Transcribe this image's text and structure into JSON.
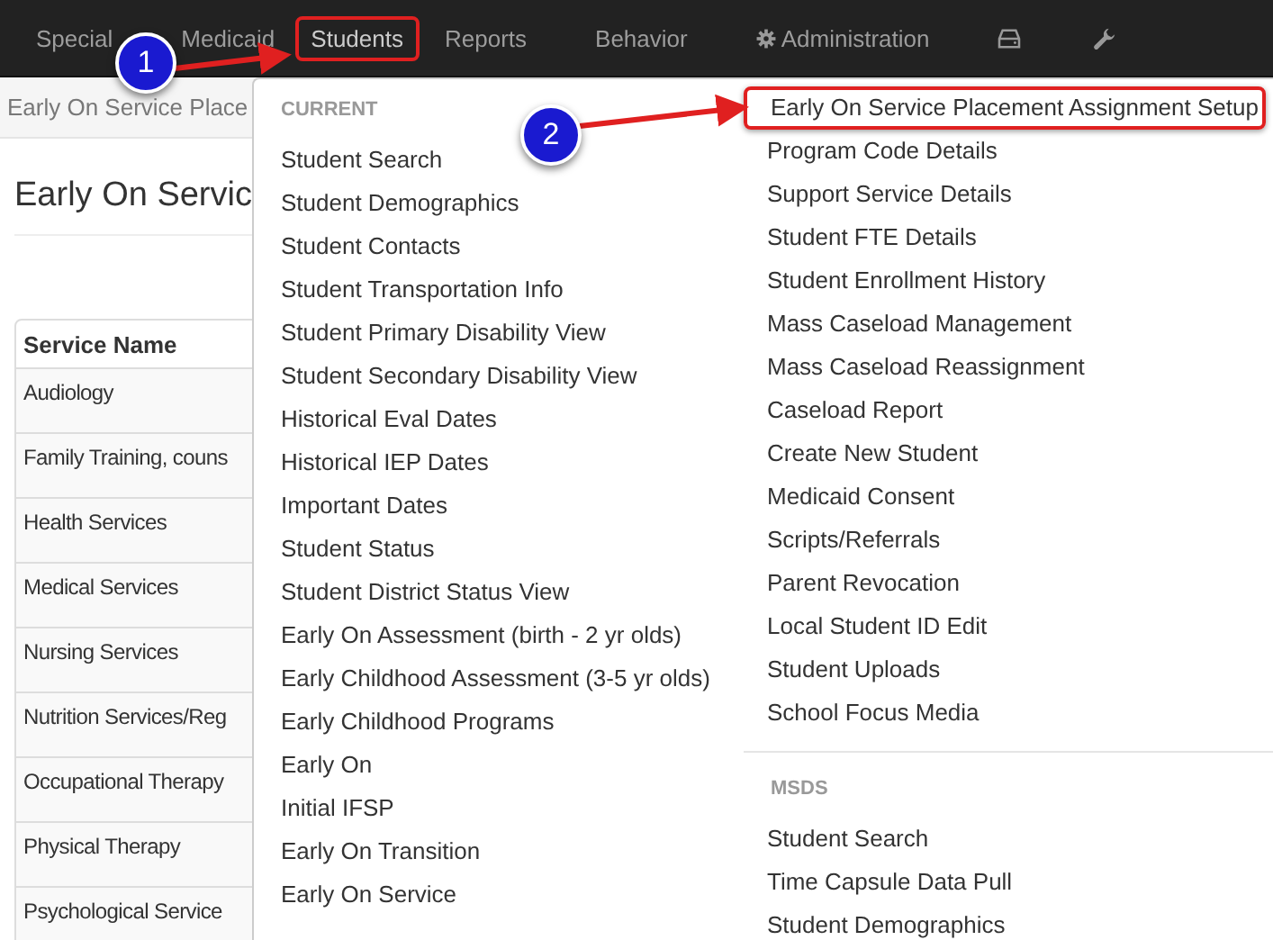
{
  "navbar": {
    "items": [
      {
        "kind": "text",
        "label": "Special",
        "annotated": false
      },
      {
        "kind": "text",
        "label": "Medicaid",
        "annotated": false
      },
      {
        "kind": "text",
        "label": "Students",
        "annotated": true
      },
      {
        "kind": "text",
        "label": "Reports",
        "annotated": false
      },
      {
        "kind": "text",
        "label": "Behavior",
        "annotated": false
      },
      {
        "kind": "gear",
        "label": "Administration",
        "annotated": false
      },
      {
        "kind": "tray",
        "annotated": false
      },
      {
        "kind": "wrench",
        "annotated": false
      }
    ]
  },
  "breadcrumb": "Early On Service Place",
  "heading": "Early On Servic",
  "table": {
    "columns": [
      "Service Name"
    ],
    "rows": [
      [
        "Audiology"
      ],
      [
        "Family Training, couns"
      ],
      [
        "Health Services"
      ],
      [
        "Medical Services"
      ],
      [
        "Nursing Services"
      ],
      [
        "Nutrition Services/Reg"
      ],
      [
        "Occupational Therapy"
      ],
      [
        "Physical Therapy"
      ],
      [
        "Psychological Service"
      ]
    ]
  },
  "menu": {
    "columns": [
      {
        "sections": [
          {
            "header": "CURRENT",
            "items": [
              {
                "label": "Student Search",
                "annotated": false
              },
              {
                "label": "Student Demographics",
                "annotated": false
              },
              {
                "label": "Student Contacts",
                "annotated": false
              },
              {
                "label": "Student Transportation Info",
                "annotated": false
              },
              {
                "label": "Student Primary Disability View",
                "annotated": false
              },
              {
                "label": "Student Secondary Disability View",
                "annotated": false
              },
              {
                "label": "Historical Eval Dates",
                "annotated": false
              },
              {
                "label": "Historical IEP Dates",
                "annotated": false
              },
              {
                "label": "Important Dates",
                "annotated": false
              },
              {
                "label": "Student Status",
                "annotated": false
              },
              {
                "label": "Student District Status View",
                "annotated": false
              },
              {
                "label": "Early On Assessment (birth - 2 yr olds)",
                "annotated": false
              },
              {
                "label": "Early Childhood Assessment (3-5 yr olds)",
                "annotated": false
              },
              {
                "label": "Early Childhood Programs",
                "annotated": false
              },
              {
                "label": "Early On",
                "annotated": false
              },
              {
                "label": "Initial IFSP",
                "annotated": false
              },
              {
                "label": "Early On Transition",
                "annotated": false
              },
              {
                "label": "Early On Service",
                "annotated": false
              }
            ]
          }
        ]
      },
      {
        "sections": [
          {
            "items": [
              {
                "label": "Early On Service Placement Assignment Setup",
                "annotated": true
              },
              {
                "label": "Program Code Details",
                "annotated": false
              },
              {
                "label": "Support Service Details",
                "annotated": false
              },
              {
                "label": "Student FTE Details",
                "annotated": false
              },
              {
                "label": "Student Enrollment History",
                "annotated": false
              },
              {
                "label": "Mass Caseload Management",
                "annotated": false
              },
              {
                "label": "Mass Caseload Reassignment",
                "annotated": false
              },
              {
                "label": "Caseload Report",
                "annotated": false
              },
              {
                "label": "Create New Student",
                "annotated": false
              },
              {
                "label": "Medicaid Consent",
                "annotated": false
              },
              {
                "label": "Scripts/Referrals",
                "annotated": false
              },
              {
                "label": "Parent Revocation",
                "annotated": false
              },
              {
                "label": "Local Student ID Edit",
                "annotated": false
              },
              {
                "label": "Student Uploads",
                "annotated": false
              },
              {
                "label": "School Focus Media",
                "annotated": false
              }
            ]
          },
          {
            "header": "MSDS",
            "items": [
              {
                "label": "Student Search",
                "annotated": false
              },
              {
                "label": "Time Capsule Data Pull",
                "annotated": false
              },
              {
                "label": "Student Demographics",
                "annotated": false
              }
            ]
          }
        ]
      }
    ]
  },
  "callouts": [
    {
      "number": "1"
    },
    {
      "number": "2"
    }
  ]
}
